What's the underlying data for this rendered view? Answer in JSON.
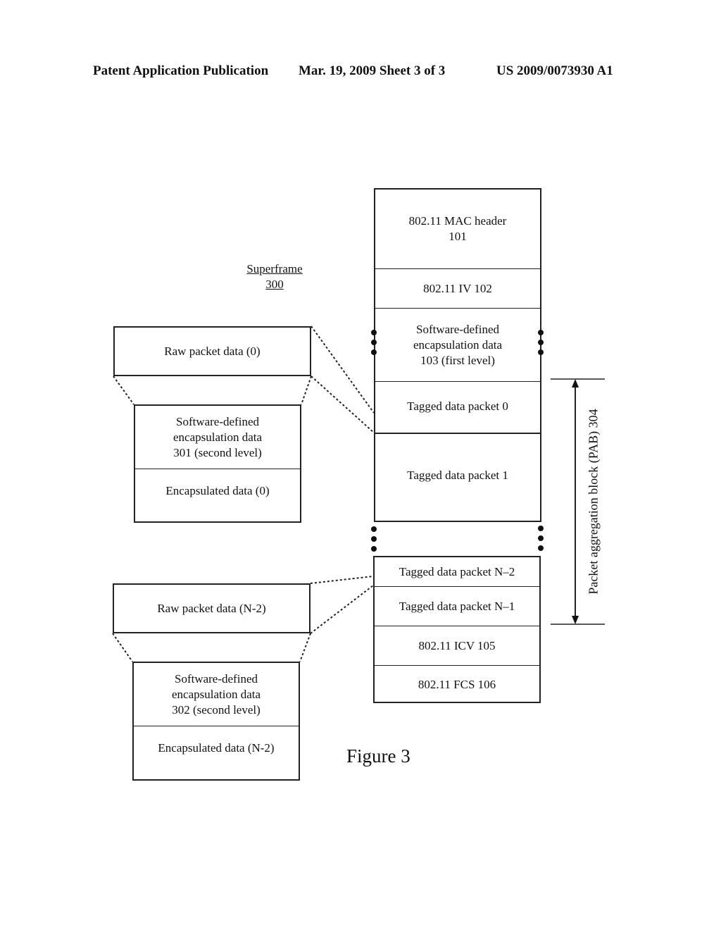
{
  "header": {
    "publication": "Patent Application Publication",
    "date_sheet": "Mar. 19, 2009  Sheet 3 of 3",
    "pub_number": "US 2009/0073930 A1"
  },
  "superframe": {
    "line1": "Superframe",
    "line2": "300"
  },
  "frame_stack": {
    "mac_header": [
      "802.11 MAC header",
      "101"
    ],
    "iv": "802.11 IV 102",
    "sw_encap_first": [
      "Software-defined",
      "encapsulation data",
      "103 (first level)"
    ],
    "tagged_0": "Tagged data packet 0",
    "tagged_1": "Tagged data packet 1",
    "tagged_n2": "Tagged data packet N–2",
    "tagged_n1": "Tagged data packet N–1",
    "icv": "802.11 ICV 105",
    "fcs": "802.11 FCS 106"
  },
  "left_top": {
    "raw": "Raw packet data (0)",
    "sw_encap": [
      "Software-defined",
      "encapsulation data",
      "301 (second level)"
    ],
    "encapsulated": "Encapsulated data (0)"
  },
  "left_bottom": {
    "raw": "Raw packet data (N-2)",
    "sw_encap": [
      "Software-defined",
      "encapsulation data",
      "302 (second level)"
    ],
    "encapsulated": "Encapsulated data (N-2)"
  },
  "pab_label": "Packet aggregation block (PAB) 304",
  "figure_caption": "Figure 3"
}
